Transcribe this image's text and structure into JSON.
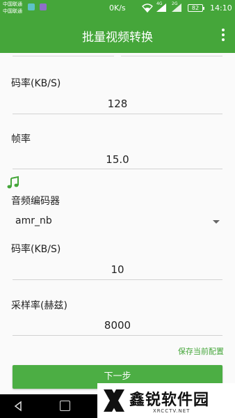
{
  "status_bar": {
    "carrier_1": "中国联通",
    "carrier_2": "中国联通",
    "net_speed": "0K/s",
    "signal_1_tag": "4G",
    "signal_2_tag": "2G",
    "battery": "82",
    "time": "14:10"
  },
  "app_bar": {
    "title": "批量视频转换",
    "menu_icon": "overflow-menu-icon"
  },
  "video": {
    "bitrate_label": "码率(KB/S)",
    "bitrate_value": "128",
    "framerate_label": "帧率",
    "framerate_value": "15.0"
  },
  "audio": {
    "icon": "music-note-icon",
    "encoder_label": "音频编码器",
    "encoder_value": "amr_nb",
    "bitrate_label": "码率(KB/S)",
    "bitrate_value": "10",
    "samplerate_label": "采样率(赫兹)",
    "samplerate_value": "8000"
  },
  "actions": {
    "save_config": "保存当前配置",
    "next": "下一步"
  },
  "watermark": {
    "name": "鑫锐软件园",
    "url": "XRCCTV.NET"
  },
  "colors": {
    "primary": "#45a63a",
    "button": "#4cae44"
  }
}
